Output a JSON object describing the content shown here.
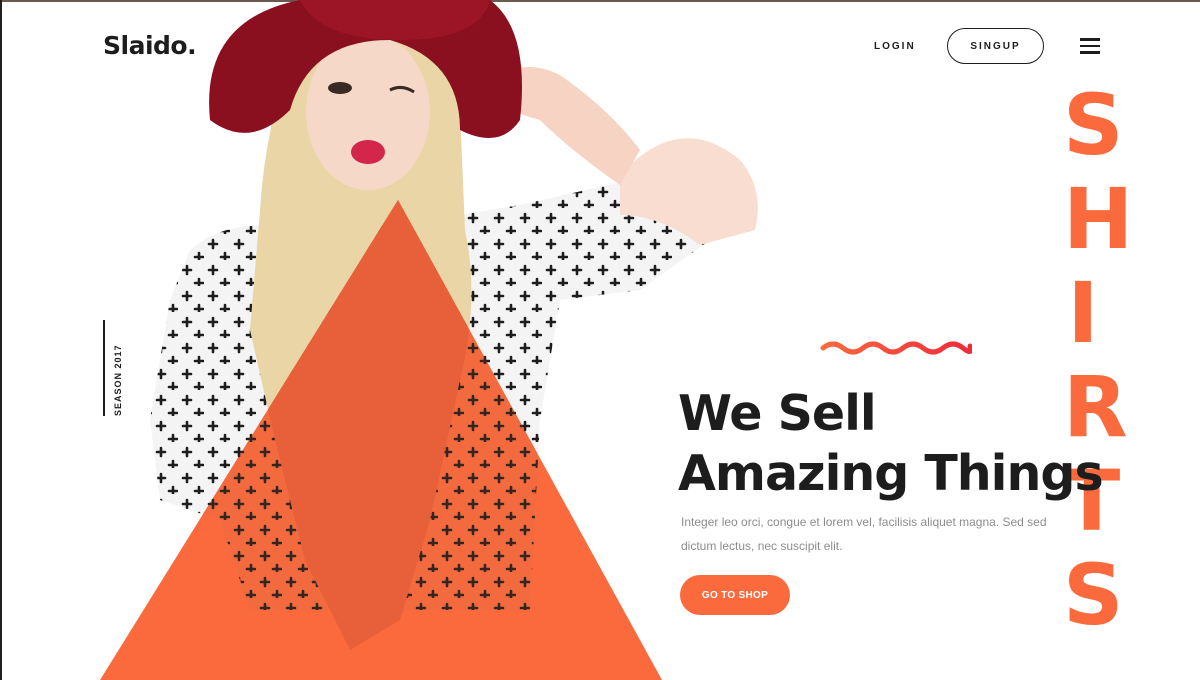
{
  "header": {
    "logo": "Slaido.",
    "nav": {
      "login_label": "LOGIN",
      "signup_label": "SINGUP"
    },
    "menu_icon": "hamburger-menu-icon"
  },
  "hero": {
    "season_label": "SEASON 2017",
    "vertical_word": [
      "S",
      "H",
      "I",
      "R",
      "T",
      "S"
    ],
    "headline_line1": "We Sell",
    "headline_line2": "Amazing Things",
    "body_text": "Integer leo orci, congue et lorem vel, facilisis aliquet magna. Sed sed dictum lectus, nec suscipit elit.",
    "cta_label": "GO TO SHOP",
    "image": "fashion-model-photo"
  },
  "colors": {
    "accent": "#fa6a3c",
    "wave_start": "#fa6a3c",
    "wave_end": "#ee2a3b",
    "text_dark": "#1d1d1d",
    "text_muted": "#8d8d8d",
    "hat": "#8a1020"
  }
}
